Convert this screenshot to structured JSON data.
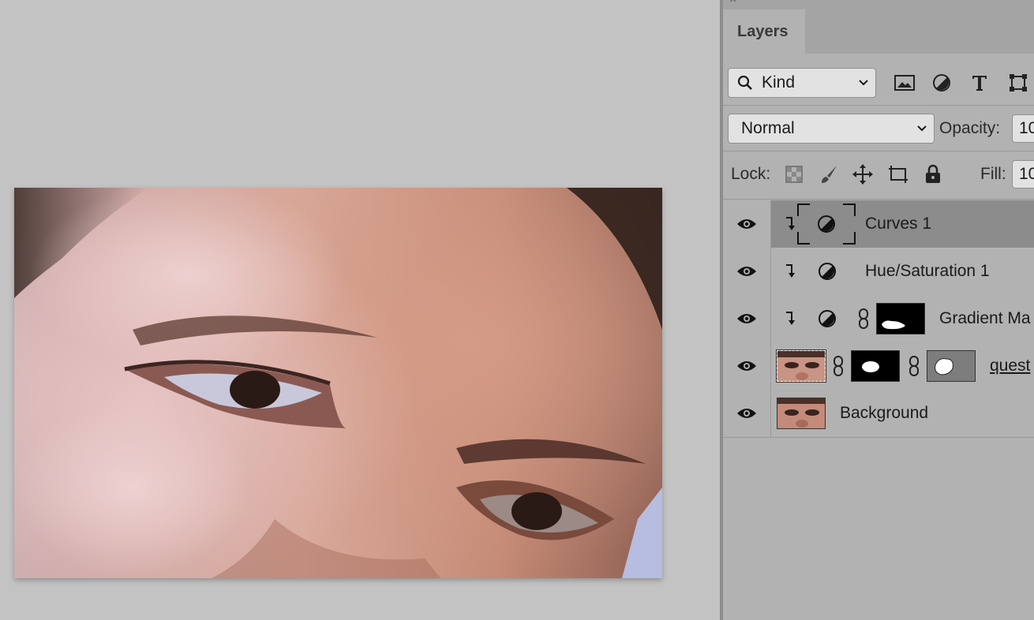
{
  "panel": {
    "close_glyph": "×",
    "tab_label": "Layers",
    "filter": {
      "kind_label": "Kind"
    },
    "blend": {
      "mode": "Normal",
      "opacity_label": "Opacity:",
      "opacity_value": "10"
    },
    "lock": {
      "lock_label": "Lock:",
      "fill_label": "Fill:",
      "fill_value": "10"
    },
    "layers": [
      {
        "name": "Curves 1",
        "type": "adjustment",
        "clipped": true,
        "selected": true,
        "visible": true
      },
      {
        "name": "Hue/Saturation 1",
        "type": "adjustment",
        "clipped": true,
        "selected": false,
        "visible": true
      },
      {
        "name": "Gradient Ma",
        "type": "adjustment-masked",
        "clipped": true,
        "selected": false,
        "visible": true
      },
      {
        "name": "quest",
        "type": "smart-object-masked",
        "clipped": false,
        "selected": false,
        "visible": true
      },
      {
        "name": "Background",
        "type": "image",
        "clipped": false,
        "selected": false,
        "visible": true
      }
    ]
  },
  "colors": {
    "canvas_bg": "#c3c3c3",
    "panel_bg": "#b2b2b2",
    "selected_row": "#8c8c8c"
  }
}
